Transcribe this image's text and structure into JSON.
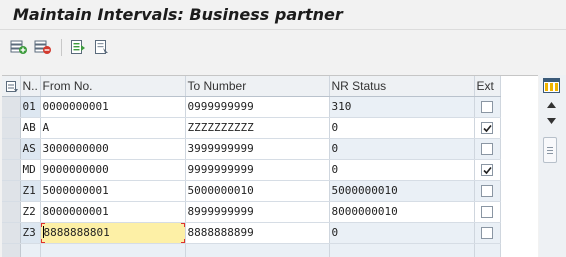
{
  "window": {
    "title": "Maintain Intervals: Business partner"
  },
  "toolbar": {
    "buttons": [
      {
        "name": "insert-row-icon"
      },
      {
        "name": "delete-row-icon"
      },
      {
        "name": "display-details-icon"
      },
      {
        "name": "change-details-icon"
      }
    ]
  },
  "table": {
    "columns": [
      "N..",
      "From No.",
      "To Number",
      "NR Status",
      "Ext"
    ],
    "rows": [
      {
        "n": "01",
        "from": "0000000001",
        "to": "0999999999",
        "status": "310",
        "ext": false
      },
      {
        "n": "AB",
        "from": "A",
        "to": "ZZZZZZZZZZ",
        "status": "0",
        "ext": true
      },
      {
        "n": "AS",
        "from": "3000000000",
        "to": "3999999999",
        "status": "0",
        "ext": false
      },
      {
        "n": "MD",
        "from": "9000000000",
        "to": "9999999999",
        "status": "0",
        "ext": true
      },
      {
        "n": "Z1",
        "from": "5000000001",
        "to": "5000000010",
        "status": "5000000010",
        "ext": false
      },
      {
        "n": "Z2",
        "from": "8000000001",
        "to": "8999999999",
        "status": "8000000010",
        "ext": false
      },
      {
        "n": "Z3",
        "from": "8888888801",
        "to": "8888888899",
        "status": "0",
        "ext": false
      }
    ]
  },
  "colors": {
    "focus_cell": "#fdf0a6",
    "selection_column": "#dfe3e8",
    "header": "#eef1f4"
  }
}
